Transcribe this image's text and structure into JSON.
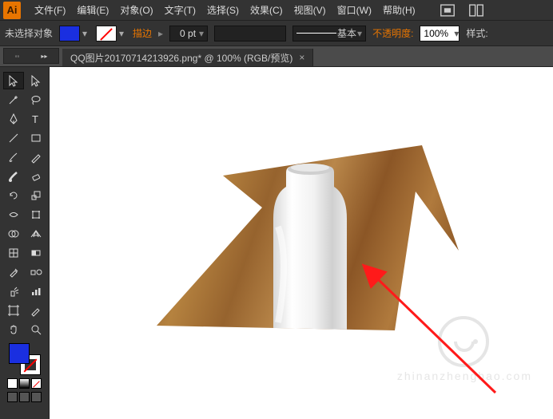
{
  "app": {
    "icon_text": "Ai"
  },
  "menu": {
    "items": [
      {
        "label": "文件(F)"
      },
      {
        "label": "编辑(E)"
      },
      {
        "label": "对象(O)"
      },
      {
        "label": "文字(T)"
      },
      {
        "label": "选择(S)"
      },
      {
        "label": "效果(C)"
      },
      {
        "label": "视图(V)"
      },
      {
        "label": "窗口(W)"
      },
      {
        "label": "帮助(H)"
      }
    ]
  },
  "controlbar": {
    "selection_status": "未选择对象",
    "stroke_label": "描边",
    "stroke_weight": "0 pt",
    "brush_style": "基本",
    "opacity_label": "不透明度:",
    "opacity_value": "100%",
    "style_label": "样式:"
  },
  "tab": {
    "title": "QQ图片20170714213926.png* @ 100% (RGB/预览)",
    "close": "×"
  },
  "tools": [
    "selection-tool",
    "direct-selection-tool",
    "magic-wand-tool",
    "lasso-tool",
    "pen-tool",
    "type-tool",
    "line-segment-tool",
    "rectangle-tool",
    "paintbrush-tool",
    "pencil-tool",
    "blob-brush-tool",
    "eraser-tool",
    "rotate-tool",
    "scale-tool",
    "width-tool",
    "free-transform-tool",
    "shape-builder-tool",
    "perspective-grid-tool",
    "mesh-tool",
    "gradient-tool",
    "eyedropper-tool",
    "blend-tool",
    "symbol-sprayer-tool",
    "column-graph-tool",
    "artboard-tool",
    "slice-tool",
    "hand-tool",
    "zoom-tool"
  ],
  "colors": {
    "fill_blue": "#1a2fe0",
    "accent": "#e87500"
  },
  "watermark": "zhinanzhenghao.com"
}
